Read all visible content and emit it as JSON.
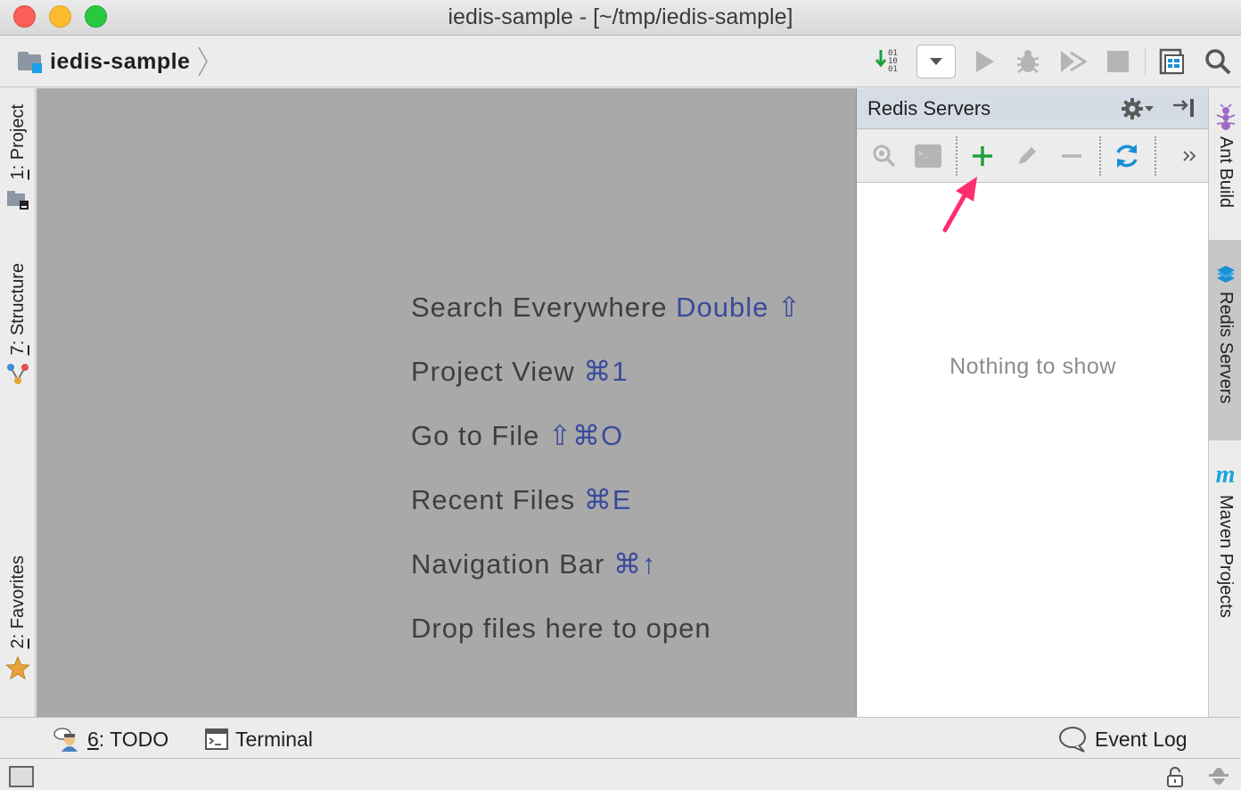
{
  "window": {
    "title": "iedis-sample - [~/tmp/iedis-sample]"
  },
  "navbar": {
    "project_label": "iedis-sample"
  },
  "left_tabs": {
    "project": {
      "num": "1",
      "label": ": Project"
    },
    "structure": {
      "num": "7",
      "label": ": Structure"
    },
    "favorites": {
      "num": "2",
      "label": ": Favorites"
    }
  },
  "editor": {
    "hints": [
      {
        "text": "Search Everywhere ",
        "key": "Double ⇧"
      },
      {
        "text": "Project View ",
        "key": "⌘1"
      },
      {
        "text": "Go to File ",
        "key": "⇧⌘O"
      },
      {
        "text": "Recent Files ",
        "key": "⌘E"
      },
      {
        "text": "Navigation Bar ",
        "key": "⌘↑"
      },
      {
        "text": "Drop files here to open",
        "key": ""
      }
    ]
  },
  "redis_panel": {
    "title": "Redis Servers",
    "empty_text": "Nothing to show"
  },
  "right_tabs": {
    "ant_build": "Ant Build",
    "redis_servers": "Redis Servers",
    "maven_projects": "Maven Projects",
    "maven_glyph": "m"
  },
  "bottom_tabs": {
    "todo": {
      "num": "6",
      "label": ": TODO"
    },
    "terminal": "Terminal",
    "event_log": "Event Log"
  },
  "colors": {
    "accent_add": "#1fa03c",
    "annotation_arrow": "#ff2d6f",
    "shortcut_text": "#3a4b9c",
    "panel_header": "#d6dce6"
  }
}
